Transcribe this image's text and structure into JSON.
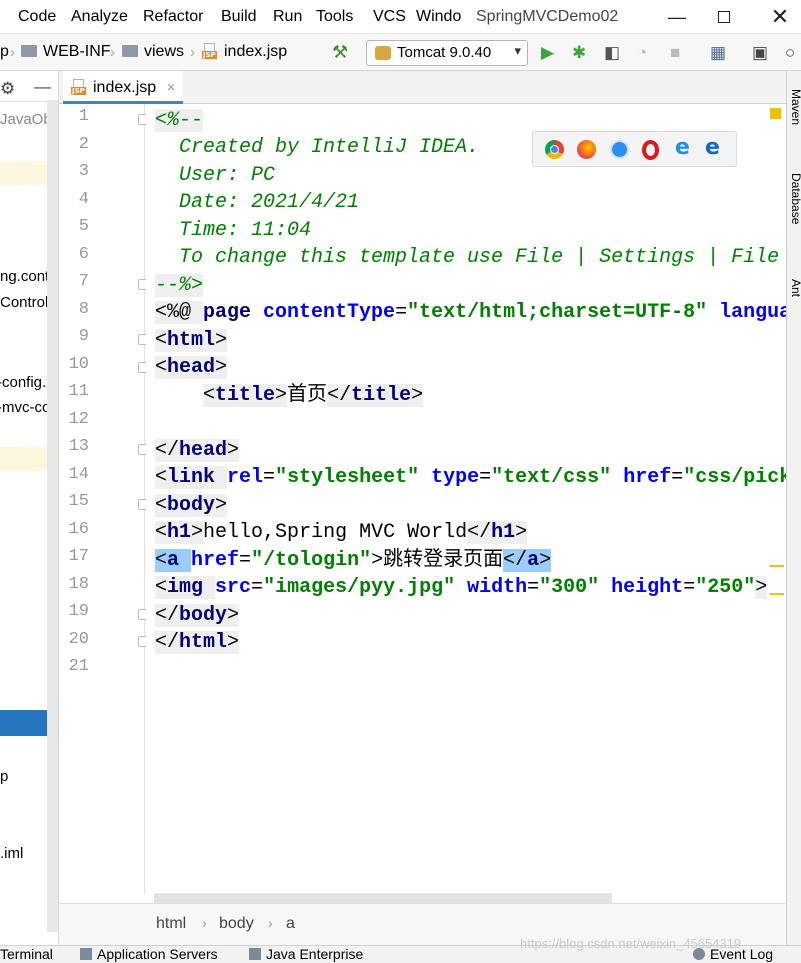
{
  "menu": {
    "items": [
      "Code",
      "Analyze",
      "Refactor",
      "Build",
      "Run",
      "Tools",
      "VCS",
      "Windo"
    ]
  },
  "window": {
    "title": "SpringMVCDemo02"
  },
  "nav": {
    "crumb0": "p",
    "crumbs": [
      "WEB-INF",
      "views",
      "index.jsp"
    ],
    "run_config": "Tomcat 9.0.40",
    "arrow": "▾"
  },
  "tree": {
    "items": [
      "JavaObj",
      "ng.contr",
      "Controlle",
      "-config.x",
      "-mvc-co",
      "p",
      ".iml"
    ]
  },
  "editor": {
    "tab_label": "index.jsp",
    "tab_close": "×",
    "line_numbers": [
      "1",
      "2",
      "3",
      "4",
      "5",
      "6",
      "7",
      "8",
      "9",
      "10",
      "11",
      "12",
      "13",
      "14",
      "15",
      "16",
      "17",
      "18",
      "19",
      "20",
      "21"
    ],
    "lines": {
      "l1": "<%--",
      "l2": "  Created by IntelliJ IDEA.",
      "l3": "  User: PC",
      "l4": "  Date: 2021/4/21",
      "l5": "  Time: 11:04",
      "l6": "  To change this template use File | Settings | File",
      "l7": "--%>",
      "l8_a": "<%@ ",
      "l8_b": "page ",
      "l8_c": "contentType",
      "l8_d": "=",
      "l8_e": "\"text/html;charset=UTF-8\"",
      "l8_f": " langua",
      "l9_open": "<",
      "l9_tag": "html",
      "l9_close": ">",
      "l10_open": "<",
      "l10_tag": "head",
      "l10_close": ">",
      "l11_indent": "    ",
      "l11_open": "<",
      "l11_tag": "title",
      "l11_close": ">",
      "l11_text": "首页",
      "l11_end_open": "</",
      "l11_end_tag": "title",
      "l11_end_close": ">",
      "l13_open": "</",
      "l13_tag": "head",
      "l13_close": ">",
      "l14_open": "<",
      "l14_tag": "link ",
      "l14_attr1": "rel",
      "l14_eq1": "=",
      "l14_val1": "\"stylesheet\"",
      "l14_sp1": " ",
      "l14_attr2": "type",
      "l14_eq2": "=",
      "l14_val2": "\"text/css\"",
      "l14_sp2": " ",
      "l14_attr3": "href",
      "l14_eq3": "=",
      "l14_val3": "\"css/pick",
      "l15_open": "<",
      "l15_tag": "body",
      "l15_close": ">",
      "l16_open": "<",
      "l16_tag": "h1",
      "l16_close": ">",
      "l16_text": "hello,Spring MVC World",
      "l16_end_open": "</",
      "l16_end_tag": "h1",
      "l16_end_close": ">",
      "l17_open": "<",
      "l17_tag": "a ",
      "l17_attr": "href",
      "l17_eq": "=",
      "l17_val": "\"/tologin\"",
      "l17_gt": ">",
      "l17_text": "跳转登录页面",
      "l17_end_open": "</",
      "l17_end_tag": "a",
      "l17_end_close": ">",
      "l18_open": "<",
      "l18_tag": "img ",
      "l18_attr1": "src",
      "l18_eq1": "=",
      "l18_val1": "\"images/pyy.jpg\"",
      "l18_sp1": " ",
      "l18_attr2": "width",
      "l18_eq2": "=",
      "l18_val2": "\"300\"",
      "l18_sp2": " ",
      "l18_attr3": "height",
      "l18_eq3": "=",
      "l18_val3": "\"250\"",
      "l18_gt": ">",
      "l19_open": "</",
      "l19_tag": "body",
      "l19_close": ">",
      "l20_open": "</",
      "l20_tag": "html",
      "l20_close": ">"
    }
  },
  "side_tools": {
    "right": [
      "Maven",
      "Database",
      "Ant"
    ]
  },
  "breadcrumb": {
    "items": [
      "html",
      "body",
      "a"
    ],
    "sep": "›"
  },
  "bottom": {
    "items": [
      "Terminal",
      "Application Servers",
      "Java Enterprise",
      "Event Log"
    ]
  },
  "watermark": "https://blog.csdn.net/weixin_45654319",
  "colors": {
    "accent": "#4083c9",
    "comment": "#008000",
    "tag": "#000080",
    "attr": "#0000ff",
    "selection": "#99ccff",
    "caret_line": "#fffae3"
  }
}
